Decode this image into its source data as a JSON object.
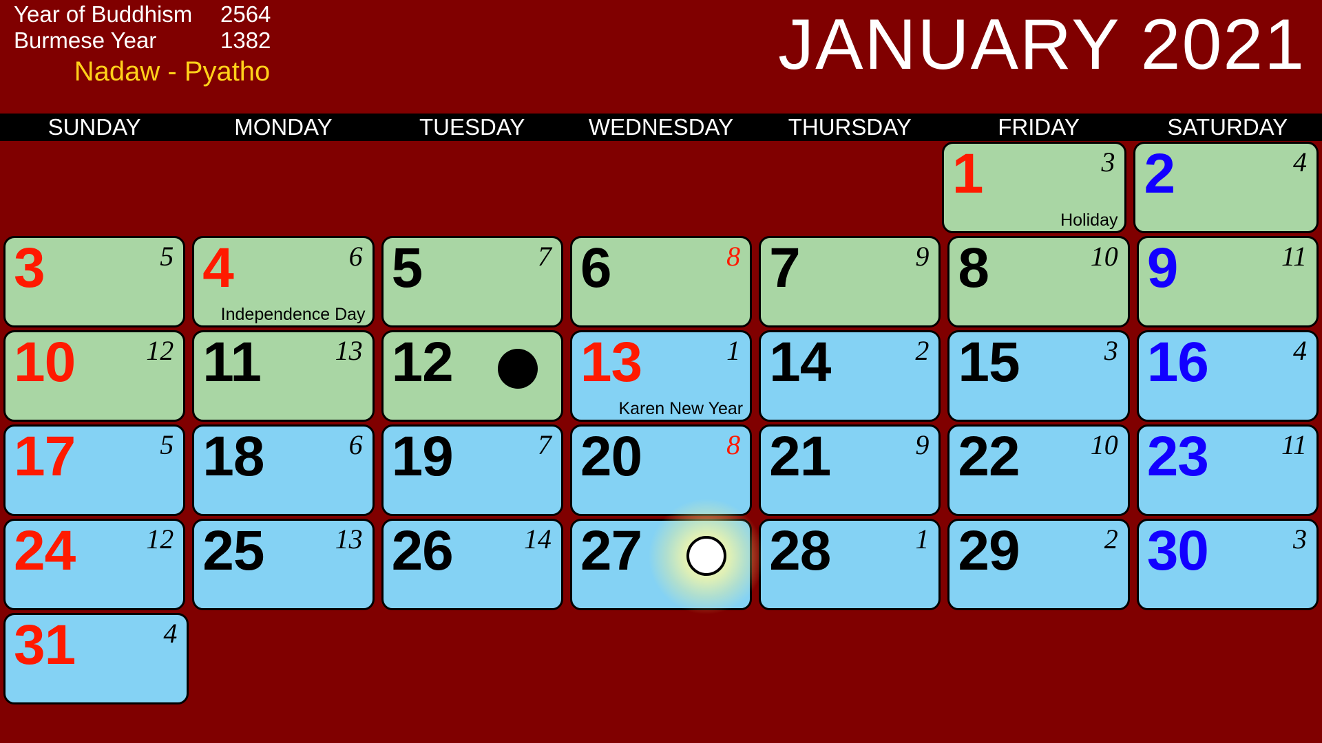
{
  "header": {
    "buddhism_label": "Year of Buddhism",
    "buddhism_value": "2564",
    "burmese_label": "Burmese Year",
    "burmese_value": "1382",
    "burmese_month": "Nadaw - Pyatho",
    "month_title": "JANUARY 2021"
  },
  "weekdays": [
    "SUNDAY",
    "MONDAY",
    "TUESDAY",
    "WEDNESDAY",
    "THURSDAY",
    "FRIDAY",
    "SATURDAY"
  ],
  "colors": {
    "background": "#800000",
    "bar": "#000000",
    "green_cell": "#a9d6a4",
    "blue_cell": "#84d2f4",
    "sunday": "#ff1a00",
    "saturday": "#1200ff",
    "weekday": "#000000",
    "month_accent": "#ffd11a"
  },
  "weeks": [
    [
      {
        "empty": true
      },
      {
        "empty": true
      },
      {
        "empty": true
      },
      {
        "empty": true
      },
      {
        "empty": true
      },
      {
        "day": "1",
        "lunar": "3",
        "shade": "green",
        "day_color": "sun",
        "lunar_color": "black",
        "event": "Holiday",
        "moon": ""
      },
      {
        "day": "2",
        "lunar": "4",
        "shade": "green",
        "day_color": "sat",
        "lunar_color": "black",
        "event": "",
        "moon": ""
      }
    ],
    [
      {
        "day": "3",
        "lunar": "5",
        "shade": "green",
        "day_color": "sun",
        "lunar_color": "black",
        "event": "",
        "moon": ""
      },
      {
        "day": "4",
        "lunar": "6",
        "shade": "green",
        "day_color": "sun",
        "lunar_color": "black",
        "event": "Independence Day",
        "moon": ""
      },
      {
        "day": "5",
        "lunar": "7",
        "shade": "green",
        "day_color": "wd",
        "lunar_color": "black",
        "event": "",
        "moon": ""
      },
      {
        "day": "6",
        "lunar": "8",
        "shade": "green",
        "day_color": "wd",
        "lunar_color": "red",
        "event": "",
        "moon": ""
      },
      {
        "day": "7",
        "lunar": "9",
        "shade": "green",
        "day_color": "wd",
        "lunar_color": "black",
        "event": "",
        "moon": ""
      },
      {
        "day": "8",
        "lunar": "10",
        "shade": "green",
        "day_color": "wd",
        "lunar_color": "black",
        "event": "",
        "moon": ""
      },
      {
        "day": "9",
        "lunar": "11",
        "shade": "green",
        "day_color": "sat",
        "lunar_color": "black",
        "event": "",
        "moon": ""
      }
    ],
    [
      {
        "day": "10",
        "lunar": "12",
        "shade": "green",
        "day_color": "sun",
        "lunar_color": "black",
        "event": "",
        "moon": ""
      },
      {
        "day": "11",
        "lunar": "13",
        "shade": "green",
        "day_color": "wd",
        "lunar_color": "black",
        "event": "",
        "moon": ""
      },
      {
        "day": "12",
        "lunar": "",
        "shade": "green",
        "day_color": "wd",
        "lunar_color": "black",
        "event": "",
        "moon": "new"
      },
      {
        "day": "13",
        "lunar": "1",
        "shade": "blue",
        "day_color": "sun",
        "lunar_color": "black",
        "event": "Karen New Year",
        "moon": ""
      },
      {
        "day": "14",
        "lunar": "2",
        "shade": "blue",
        "day_color": "wd",
        "lunar_color": "black",
        "event": "",
        "moon": ""
      },
      {
        "day": "15",
        "lunar": "3",
        "shade": "blue",
        "day_color": "wd",
        "lunar_color": "black",
        "event": "",
        "moon": ""
      },
      {
        "day": "16",
        "lunar": "4",
        "shade": "blue",
        "day_color": "sat",
        "lunar_color": "black",
        "event": "",
        "moon": ""
      }
    ],
    [
      {
        "day": "17",
        "lunar": "5",
        "shade": "blue",
        "day_color": "sun",
        "lunar_color": "black",
        "event": "",
        "moon": ""
      },
      {
        "day": "18",
        "lunar": "6",
        "shade": "blue",
        "day_color": "wd",
        "lunar_color": "black",
        "event": "",
        "moon": ""
      },
      {
        "day": "19",
        "lunar": "7",
        "shade": "blue",
        "day_color": "wd",
        "lunar_color": "black",
        "event": "",
        "moon": ""
      },
      {
        "day": "20",
        "lunar": "8",
        "shade": "blue",
        "day_color": "wd",
        "lunar_color": "red",
        "event": "",
        "moon": ""
      },
      {
        "day": "21",
        "lunar": "9",
        "shade": "blue",
        "day_color": "wd",
        "lunar_color": "black",
        "event": "",
        "moon": ""
      },
      {
        "day": "22",
        "lunar": "10",
        "shade": "blue",
        "day_color": "wd",
        "lunar_color": "black",
        "event": "",
        "moon": ""
      },
      {
        "day": "23",
        "lunar": "11",
        "shade": "blue",
        "day_color": "sat",
        "lunar_color": "black",
        "event": "",
        "moon": ""
      }
    ],
    [
      {
        "day": "24",
        "lunar": "12",
        "shade": "blue",
        "day_color": "sun",
        "lunar_color": "black",
        "event": "",
        "moon": ""
      },
      {
        "day": "25",
        "lunar": "13",
        "shade": "blue",
        "day_color": "wd",
        "lunar_color": "black",
        "event": "",
        "moon": ""
      },
      {
        "day": "26",
        "lunar": "14",
        "shade": "blue",
        "day_color": "wd",
        "lunar_color": "black",
        "event": "",
        "moon": ""
      },
      {
        "day": "27",
        "lunar": "",
        "shade": "blue",
        "day_color": "wd",
        "lunar_color": "black",
        "event": "",
        "moon": "full"
      },
      {
        "day": "28",
        "lunar": "1",
        "shade": "blue",
        "day_color": "wd",
        "lunar_color": "black",
        "event": "",
        "moon": ""
      },
      {
        "day": "29",
        "lunar": "2",
        "shade": "blue",
        "day_color": "wd",
        "lunar_color": "black",
        "event": "",
        "moon": ""
      },
      {
        "day": "30",
        "lunar": "3",
        "shade": "blue",
        "day_color": "sat",
        "lunar_color": "black",
        "event": "",
        "moon": ""
      }
    ],
    [
      {
        "day": "31",
        "lunar": "4",
        "shade": "blue",
        "day_color": "sun",
        "lunar_color": "black",
        "event": "",
        "moon": ""
      },
      {
        "empty": true
      },
      {
        "empty": true
      },
      {
        "empty": true
      },
      {
        "empty": true
      },
      {
        "empty": true
      },
      {
        "empty": true
      }
    ]
  ]
}
